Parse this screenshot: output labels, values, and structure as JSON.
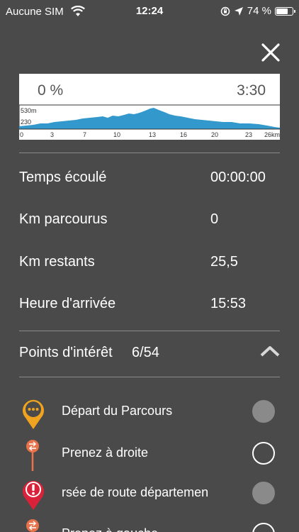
{
  "status_bar": {
    "carrier": "Aucune SIM",
    "time": "12:24",
    "battery": "74 %"
  },
  "profile": {
    "progress": "0 %",
    "duration": "3:30",
    "elev_high": "530m",
    "elev_low": "230",
    "ticks": [
      "0",
      "3",
      "7",
      "10",
      "13",
      "16",
      "20",
      "23",
      "26km"
    ],
    "fill_color": "#3399cc"
  },
  "stats": [
    {
      "label": "Temps écoulé",
      "value": "00:00:00"
    },
    {
      "label": "Km parcourus",
      "value": "0"
    },
    {
      "label": "Km restants",
      "value": "25,5"
    },
    {
      "label": "Heure d'arrivée",
      "value": "15:53"
    }
  ],
  "poi_header": {
    "label": "Points d'intérêt",
    "count": "6/54"
  },
  "poi": [
    {
      "name": "Départ du Parcours",
      "icon": "ellipsis-pin-icon",
      "checked": true
    },
    {
      "name": "Prenez à droite",
      "icon": "turn-right-pin-icon",
      "checked": false
    },
    {
      "name": "rsée de route départemen",
      "icon": "warning-pin-icon",
      "checked": true
    },
    {
      "name": "Prenez à gauche",
      "icon": "turn-left-pin-icon",
      "checked": false
    }
  ],
  "colors": {
    "background": "#4a4a4a",
    "orange_pin": "#f0a31f",
    "red_pin": "#d9223a",
    "route_pin": "#e8724a"
  }
}
